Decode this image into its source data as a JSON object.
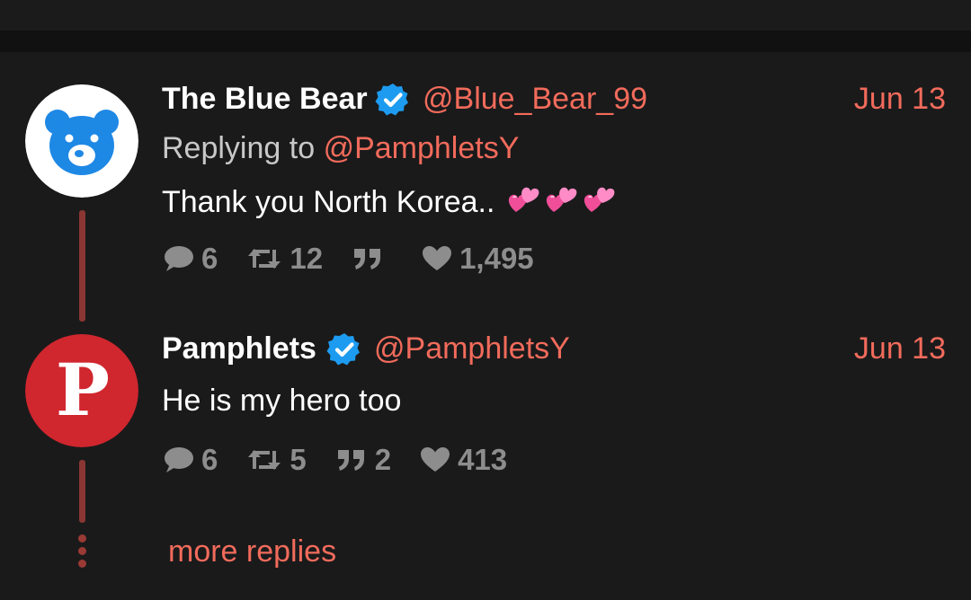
{
  "tweets": [
    {
      "name": "The Blue Bear",
      "handle": "@Blue_Bear_99",
      "date": "Jun 13",
      "replying_prefix": "Replying to",
      "replying_to": "@PamphletsY",
      "text": "Thank you North Korea..",
      "emoji": [
        "two-hearts",
        "two-hearts",
        "two-hearts"
      ],
      "avatar_icon": "blue-bear-icon",
      "stats": {
        "replies": "6",
        "retweets": "12",
        "quotes": "",
        "likes": "1,495"
      }
    },
    {
      "name": "Pamphlets",
      "handle": "@PamphletsY",
      "date": "Jun 13",
      "text": "He is my hero too",
      "avatar_icon": "letter-p-icon",
      "avatar_letter": "P",
      "stats": {
        "replies": "6",
        "retweets": "5",
        "quotes": "2",
        "likes": "413"
      }
    }
  ],
  "more_replies": "more replies",
  "colors": {
    "accent": "#f26b5b",
    "background": "#1a1a1b",
    "verified": "#1d9bf0",
    "thread_line": "#8a3632",
    "bear_blue": "#1e88e5",
    "pamphlets_red": "#d0262e"
  }
}
